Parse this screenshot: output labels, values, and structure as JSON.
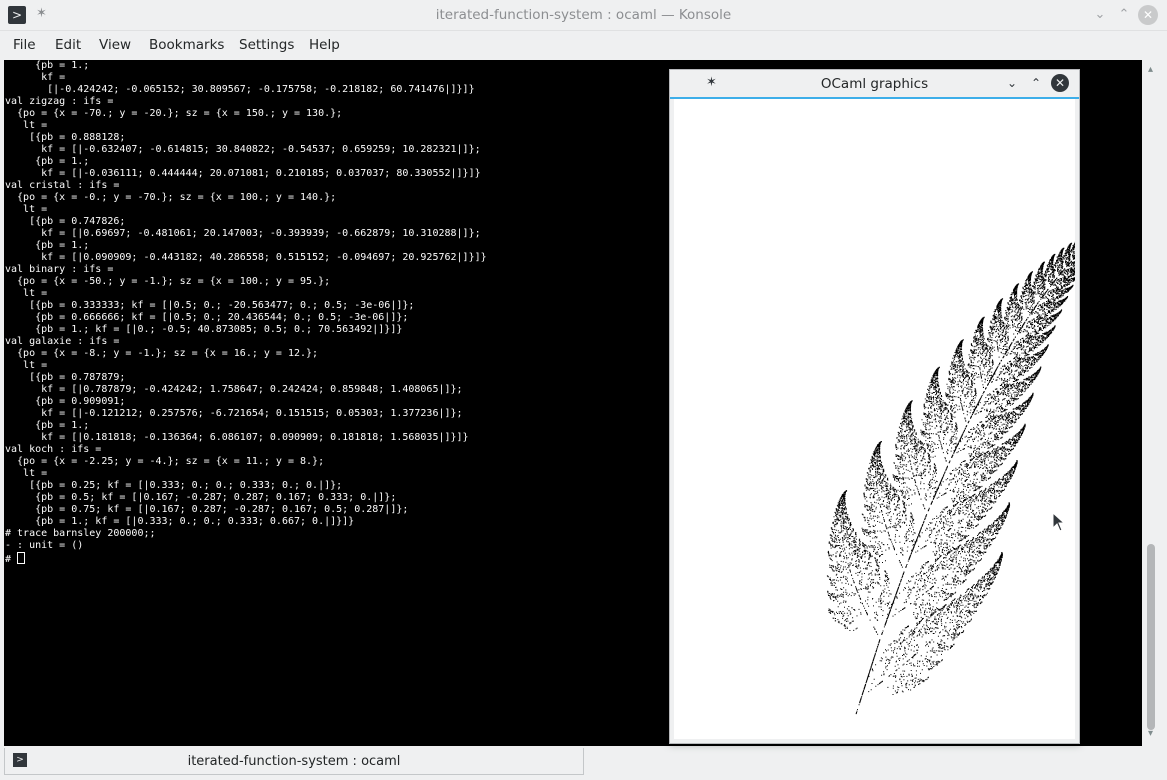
{
  "window": {
    "title": "iterated-function-system : ocaml — Konsole"
  },
  "menubar": [
    "File",
    "Edit",
    "View",
    "Bookmarks",
    "Settings",
    "Help"
  ],
  "terminal": {
    "lines": [
      "     {pb = 1.;",
      "      kf =",
      "       [|-0.424242; -0.065152; 30.809567; -0.175758; -0.218182; 60.741476|]}]}",
      "val zigzag : ifs =",
      "  {po = {x = -70.; y = -20.}; sz = {x = 150.; y = 130.};",
      "   lt =",
      "    [{pb = 0.888128;",
      "      kf = [|-0.632407; -0.614815; 30.840822; -0.54537; 0.659259; 10.282321|]};",
      "     {pb = 1.;",
      "      kf = [|-0.036111; 0.444444; 20.071081; 0.210185; 0.037037; 80.330552|]}]}",
      "val cristal : ifs =",
      "  {po = {x = -0.; y = -70.}; sz = {x = 100.; y = 140.};",
      "   lt =",
      "    [{pb = 0.747826;",
      "      kf = [|0.69697; -0.481061; 20.147003; -0.393939; -0.662879; 10.310288|]};",
      "     {pb = 1.;",
      "      kf = [|0.090909; -0.443182; 40.286558; 0.515152; -0.094697; 20.925762|]}]}",
      "val binary : ifs =",
      "  {po = {x = -50.; y = -1.}; sz = {x = 100.; y = 95.};",
      "   lt =",
      "    [{pb = 0.333333; kf = [|0.5; 0.; -20.563477; 0.; 0.5; -3e-06|]};",
      "     {pb = 0.666666; kf = [|0.5; 0.; 20.436544; 0.; 0.5; -3e-06|]};",
      "     {pb = 1.; kf = [|0.; -0.5; 40.873085; 0.5; 0.; 70.563492|]}]}",
      "val galaxie : ifs =",
      "  {po = {x = -8.; y = -1.}; sz = {x = 16.; y = 12.};",
      "   lt =",
      "    [{pb = 0.787879;",
      "      kf = [|0.787879; -0.424242; 1.758647; 0.242424; 0.859848; 1.408065|]};",
      "     {pb = 0.909091;",
      "      kf = [|-0.121212; 0.257576; -6.721654; 0.151515; 0.05303; 1.377236|]};",
      "     {pb = 1.;",
      "      kf = [|0.181818; -0.136364; 6.086107; 0.090909; 0.181818; 1.568035|]}]}",
      "val koch : ifs =",
      "  {po = {x = -2.25; y = -4.}; sz = {x = 11.; y = 8.};",
      "   lt =",
      "    [{pb = 0.25; kf = [|0.333; 0.; 0.; 0.333; 0.; 0.|]};",
      "     {pb = 0.5; kf = [|0.167; -0.287; 0.287; 0.167; 0.333; 0.|]};",
      "     {pb = 0.75; kf = [|0.167; 0.287; -0.287; 0.167; 0.5; 0.287|]};",
      "     {pb = 1.; kf = [|0.333; 0.; 0.; 0.333; 0.667; 0.|]}]}",
      "# trace barnsley 200000;;",
      "- : unit = ()"
    ],
    "prompt": "# "
  },
  "graphics_window": {
    "title": "OCaml graphics"
  },
  "session_tab": {
    "label": "iterated-function-system : ocaml"
  },
  "colors": {
    "accent": "#3daee9",
    "terminal_bg": "#000000",
    "terminal_fg": "#fcfcfc"
  },
  "icons": [
    "terminal-app-icon",
    "pin-icon",
    "minimize-icon",
    "maximize-icon",
    "close-icon",
    "scroll-up-arrow-icon",
    "scroll-down-arrow-icon",
    "mouse-pointer-icon"
  ]
}
